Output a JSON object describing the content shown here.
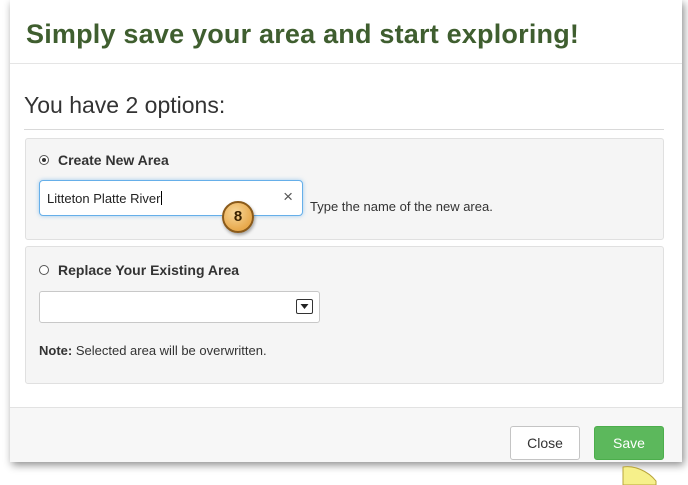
{
  "dialog": {
    "title": "Simply save your area and start exploring!",
    "options_heading": "You have 2 options:"
  },
  "create_new": {
    "label": "Create New Area",
    "selected": true,
    "name_value": "Litteton Platte River",
    "clear_glyph": "×",
    "hint": "Type the name of the new area.",
    "step_badge": "8"
  },
  "replace_existing": {
    "label": "Replace Your Existing Area",
    "selected": false,
    "select_value": "",
    "note_label": "Note:",
    "note_text": " Selected area will be overwritten."
  },
  "footer": {
    "close_label": "Close",
    "save_label": "Save"
  },
  "colors": {
    "title": "#3f5e2f",
    "save_button": "#5cb85c",
    "input_focus": "#66afe9",
    "step_badge": "#e8a94c",
    "pointer": "#f6f08a"
  },
  "icons": {
    "clear": "close-icon",
    "select_arrow": "chevron-down-icon",
    "pointer": "tutorial-pointer-icon"
  }
}
